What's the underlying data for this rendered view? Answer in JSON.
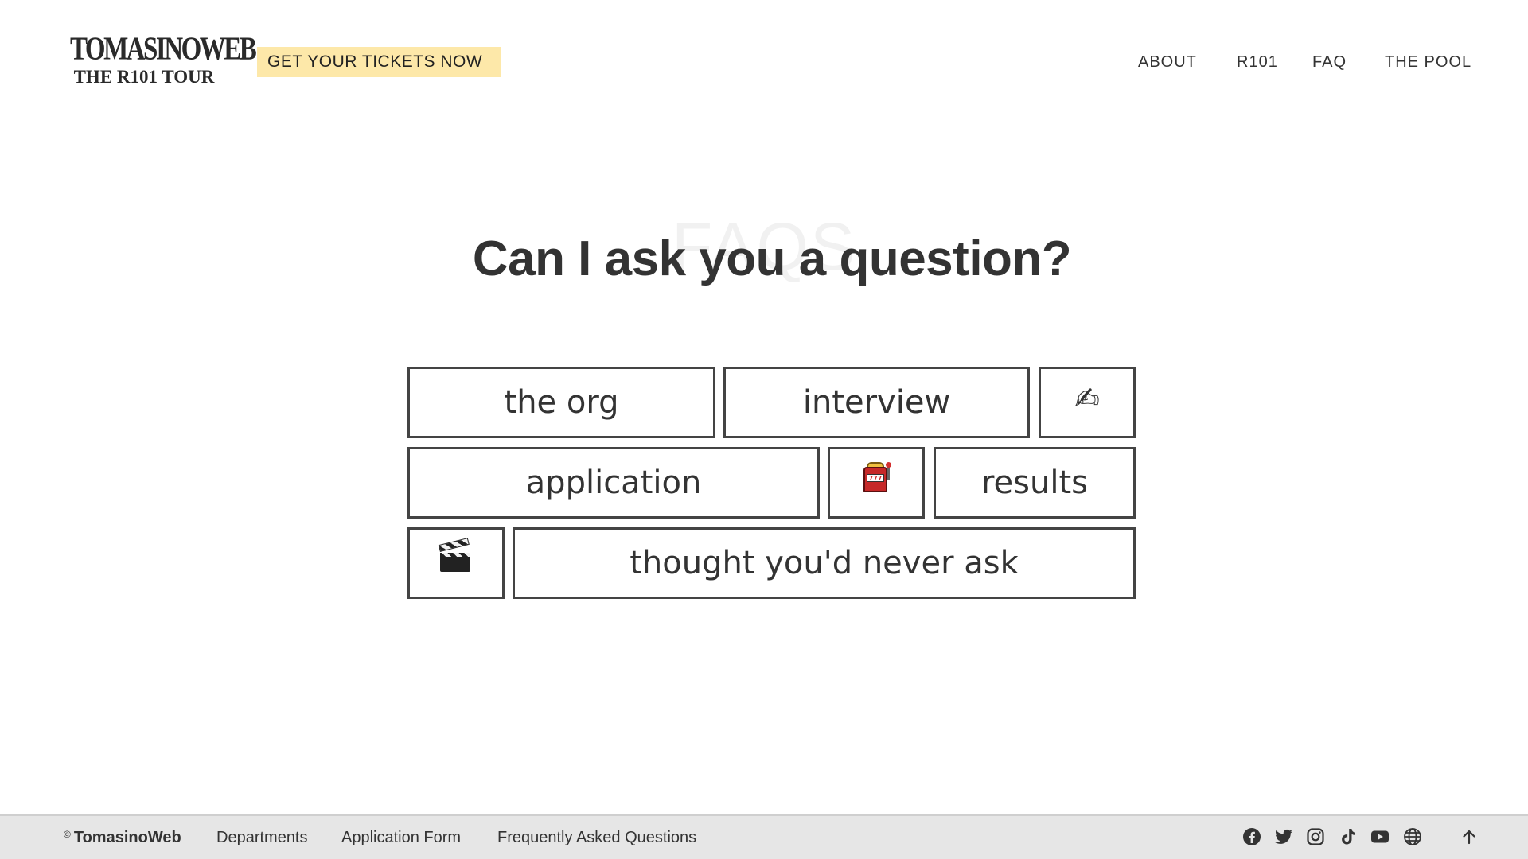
{
  "header": {
    "logo_line1": "TOMASINOWEB",
    "logo_line2": "THE R101 TOUR",
    "cta_label": "GET YOUR TICKETS NOW",
    "cta_color": "#fde8a9",
    "nav": [
      {
        "label": "ABOUT"
      },
      {
        "label": "R101"
      },
      {
        "label": "FAQ"
      },
      {
        "label": "THE POOL"
      }
    ]
  },
  "main": {
    "watermark": "FAQS",
    "heading": "Can I ask you a question?",
    "categories": [
      {
        "label": "the org"
      },
      {
        "label": "interview"
      },
      {
        "label": "✍",
        "icon": "writing-hand-icon"
      },
      {
        "label": "application"
      },
      {
        "label": "777",
        "icon": "slot-machine-icon"
      },
      {
        "label": "results"
      },
      {
        "label": "",
        "icon": "clapper-board-icon"
      },
      {
        "label": "thought you'd never ask"
      }
    ]
  },
  "footer": {
    "copyright_symbol": "©",
    "brand": "TomasinoWeb",
    "links": [
      {
        "label": "Departments"
      },
      {
        "label": "Application Form"
      },
      {
        "label": "Frequently Asked Questions"
      }
    ],
    "social_icons": [
      "facebook-icon",
      "twitter-icon",
      "instagram-icon",
      "tiktok-icon",
      "youtube-icon",
      "globe-icon"
    ],
    "back_to_top_icon": "arrow-up-icon",
    "background": "#e6e6e6"
  }
}
